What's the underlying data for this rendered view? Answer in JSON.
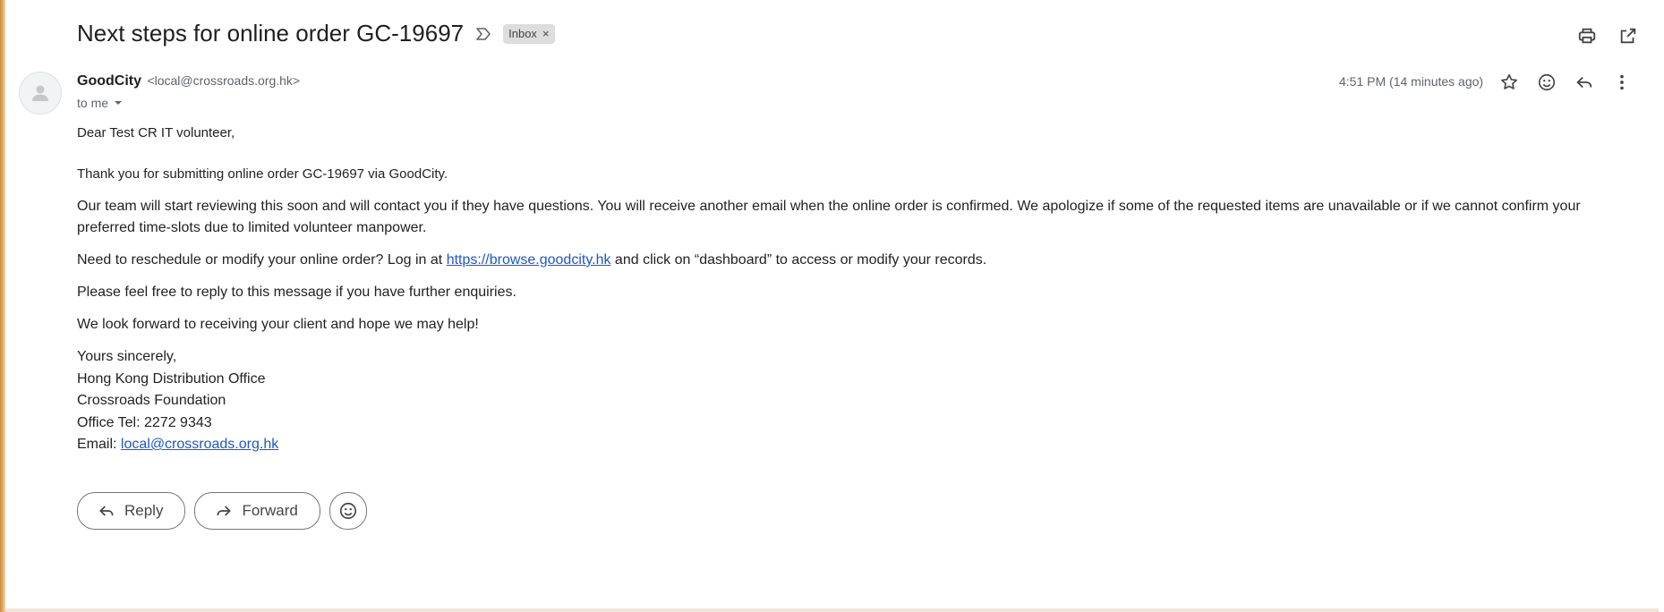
{
  "subject": "Next steps for online order GC-19697",
  "label_chip": "Inbox",
  "label_chip_close": "×",
  "sender": {
    "name": "GoodCity",
    "email": "<local@crossroads.org.hk>"
  },
  "to_me": "to me",
  "time": "4:51 PM (14 minutes ago)",
  "body": {
    "greeting": "Dear Test CR IT volunteer,",
    "thanks": "Thank you for submitting online order GC-19697 via GoodCity.",
    "review": "Our team will start reviewing this soon and will contact you if they have questions. You will receive another email when the online order is confirmed. We apologize if some of the requested items are unavailable or if we cannot confirm your preferred time-slots due to limited volunteer manpower.",
    "reschedule_pre": "Need to reschedule or modify your online order? Log in at ",
    "reschedule_link": "https://browse.goodcity.hk",
    "reschedule_post": " and click on “dashboard” to access or modify your records.",
    "reply_note": "Please feel free to reply to this message if you have further enquiries.",
    "look_forward": "We look forward to receiving your client and hope we may help!",
    "signature": {
      "closing": "Yours sincerely,",
      "office": "Hong Kong Distribution Office",
      "org": "Crossroads Foundation",
      "tel": "Office Tel: 2272 9343",
      "email_prefix": "Email: ",
      "email_link": "local@crossroads.org.hk"
    }
  },
  "actions": {
    "reply": "Reply",
    "forward": "Forward"
  },
  "icons": {
    "top": [
      "print-icon",
      "open-in-new-window-icon"
    ],
    "message": [
      "star-icon",
      "emoji-icon",
      "reply-icon",
      "more-vert-icon"
    ]
  },
  "colors": {
    "link": "#1a56d6",
    "chip_bg": "#dddddd",
    "text": "#222222",
    "muted": "#5f6368"
  }
}
